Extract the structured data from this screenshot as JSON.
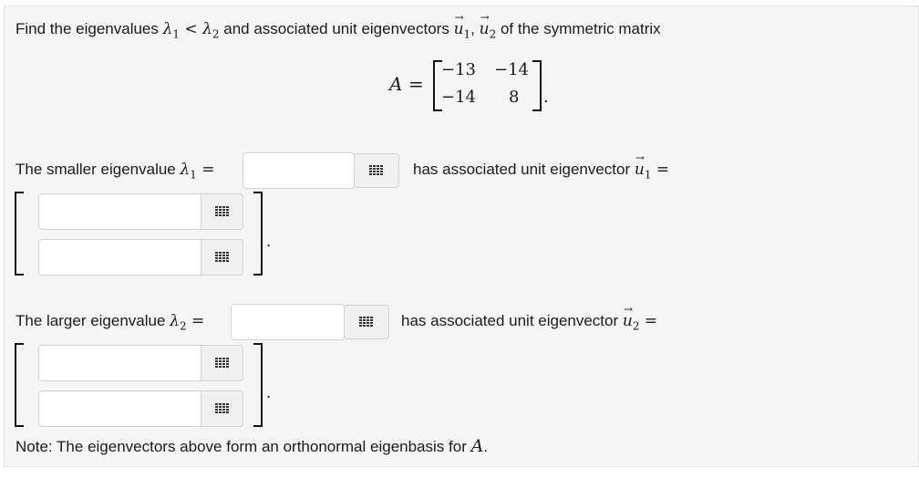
{
  "prompt": {
    "intro_before": "Find the eigenvalues ",
    "lambda1": "λ",
    "sub1": "1",
    "lt": " < ",
    "lambda2": "λ",
    "sub2": "2",
    "intro_after": " and associated unit eigenvectors ",
    "u1": "u",
    "u_sub1": "1",
    "comma": ", ",
    "u2": "u",
    "u_sub2": "2",
    "intro_tail": " of the symmetric matrix"
  },
  "matrix": {
    "name": "A",
    "equals": "=",
    "rows": [
      [
        "−13",
        "−14"
      ],
      [
        "−14",
        "8"
      ]
    ],
    "period": "."
  },
  "smaller": {
    "label": "The smaller eigenvalue ",
    "lambda": "λ",
    "sub": "1",
    "equals": " =",
    "assoc": "has associated unit eigenvector ",
    "u": "u",
    "u_sub": "1",
    "u_equals": " ="
  },
  "larger": {
    "label": "The larger eigenvalue ",
    "lambda": "λ",
    "sub": "2",
    "equals": " =",
    "assoc": "has associated unit eigenvector ",
    "u": "u",
    "u_sub": "2",
    "u_equals": " ="
  },
  "period": ".",
  "note": {
    "text": "Note: The eigenvectors above form an orthonormal eigenbasis for ",
    "A": "A",
    "end": "."
  },
  "icons": {
    "grid": "grid-icon"
  }
}
